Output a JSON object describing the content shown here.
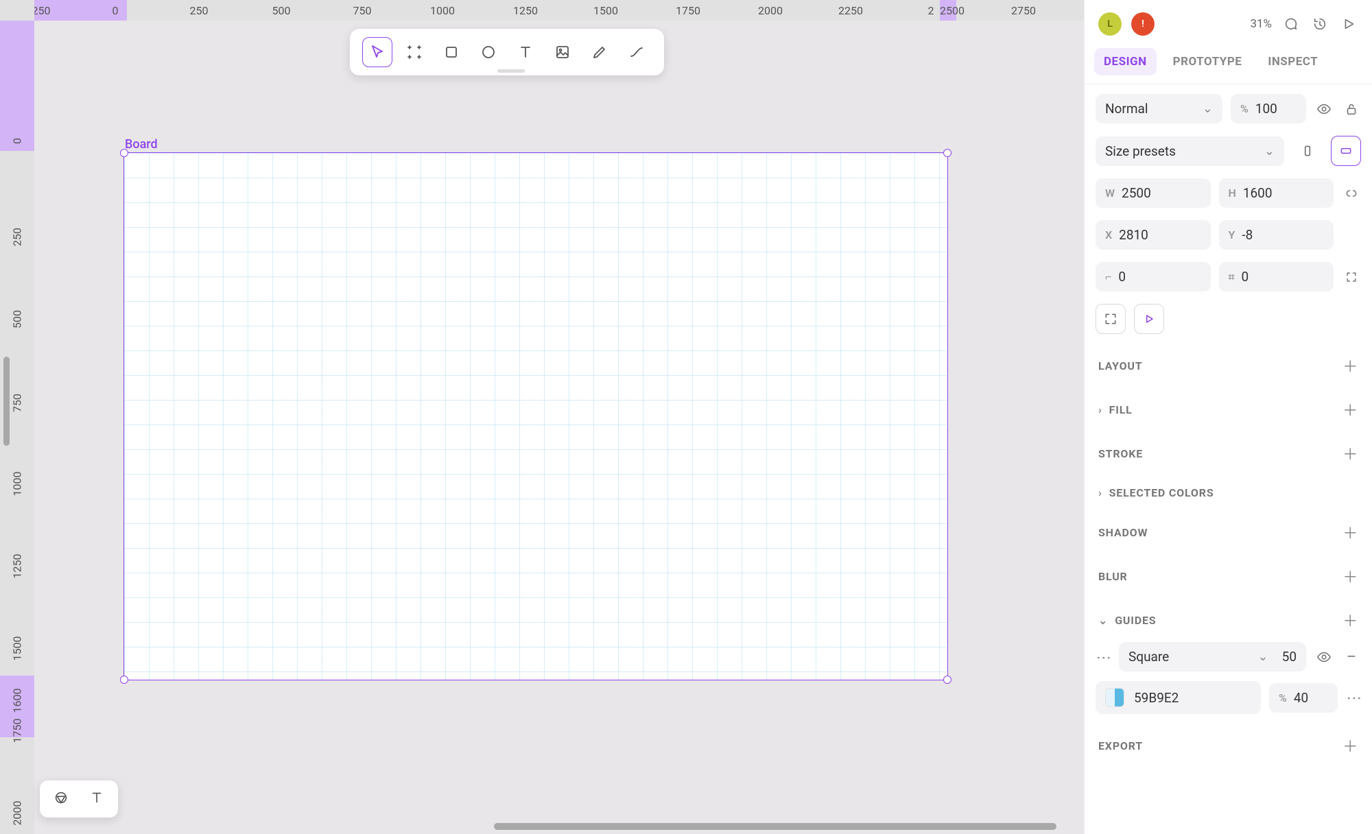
{
  "ruler_h": [
    "250",
    "0",
    "250",
    "500",
    "750",
    "1000",
    "1250",
    "1500",
    "1750",
    "2000",
    "2250",
    "2",
    "2500",
    "2750"
  ],
  "ruler_h_pos": [
    10,
    118,
    240,
    360,
    478,
    595,
    716,
    833,
    953,
    1073,
    1190,
    1307,
    1338,
    1442
  ],
  "ruler_v": [
    "0",
    "250",
    "500",
    "750",
    "1000",
    "1250",
    "1500",
    "1600",
    "1750",
    "2000"
  ],
  "ruler_v_pos": [
    196,
    336,
    456,
    578,
    696,
    816,
    936,
    1012,
    1056,
    1176
  ],
  "board_label": "Board",
  "topbar": {
    "avatars": [
      "L",
      "!"
    ],
    "zoom": "31%"
  },
  "tabs": [
    "DESIGN",
    "PROTOTYPE",
    "INSPECT"
  ],
  "blend": {
    "mode": "Normal",
    "opacity_prefix": "%",
    "opacity": "100"
  },
  "size_presets": "Size presets",
  "dims": {
    "w_l": "W",
    "w": "2500",
    "h_l": "H",
    "h": "1600",
    "x_l": "X",
    "x": "2810",
    "y_l": "Y",
    "y": "-8",
    "r": "0",
    "c": "0"
  },
  "sections": {
    "layout": "LAYOUT",
    "fill": "FILL",
    "stroke": "STROKE",
    "selected_colors": "SELECTED COLORS",
    "shadow": "SHADOW",
    "blur": "BLUR",
    "guides": "GUIDES",
    "export": "EXPORT"
  },
  "guides": {
    "type": "Square",
    "size": "50",
    "color": "59B9E2",
    "op_prefix": "%",
    "op": "40"
  }
}
